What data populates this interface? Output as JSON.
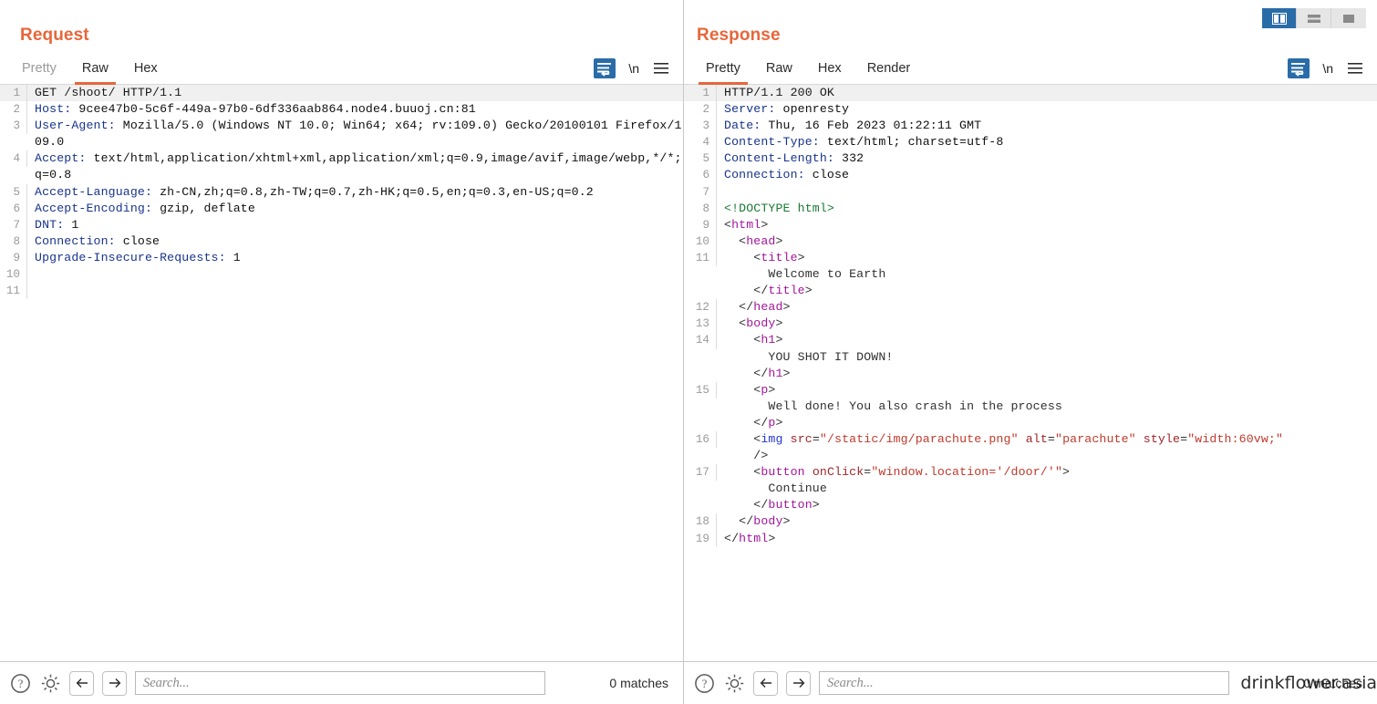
{
  "view_modes": [
    {
      "name": "side-by-side",
      "active": true
    },
    {
      "name": "stacked",
      "active": false
    },
    {
      "name": "single",
      "active": false
    }
  ],
  "request": {
    "title": "Request",
    "tabs": [
      {
        "label": "Pretty",
        "active": false
      },
      {
        "label": "Raw",
        "active": true
      },
      {
        "label": "Hex",
        "active": false
      }
    ],
    "tools": {
      "wrap": "word-wrap-icon",
      "newline": "\\n",
      "menu": "hamburger-menu-icon"
    },
    "lines": [
      {
        "num": "1",
        "segments": [
          {
            "t": "GET /shoot/ HTTP/1.1",
            "c": "plain"
          }
        ]
      },
      {
        "num": "2",
        "segments": [
          {
            "t": "Host: ",
            "c": "hname"
          },
          {
            "t": "9cee47b0-5c6f-449a-97b0-6df336aab864.node4.buuoj.cn:81",
            "c": "hval"
          }
        ]
      },
      {
        "num": "3",
        "segments": [
          {
            "t": "User-Agent: ",
            "c": "hname"
          },
          {
            "t": "Mozilla/5.0 (Windows NT 10.0; Win64; x64; rv:109.0) Gecko/20100101 Firefox/109.0",
            "c": "hval"
          }
        ]
      },
      {
        "num": "4",
        "segments": [
          {
            "t": "Accept: ",
            "c": "hname"
          },
          {
            "t": "text/html,application/xhtml+xml,application/xml;q=0.9,image/avif,image/webp,*/*;q=0.8",
            "c": "hval"
          }
        ]
      },
      {
        "num": "5",
        "segments": [
          {
            "t": "Accept-Language: ",
            "c": "hname"
          },
          {
            "t": "zh-CN,zh;q=0.8,zh-TW;q=0.7,zh-HK;q=0.5,en;q=0.3,en-US;q=0.2",
            "c": "hval"
          }
        ]
      },
      {
        "num": "6",
        "segments": [
          {
            "t": "Accept-Encoding: ",
            "c": "hname"
          },
          {
            "t": "gzip, deflate",
            "c": "hval"
          }
        ]
      },
      {
        "num": "7",
        "segments": [
          {
            "t": "DNT: ",
            "c": "hname"
          },
          {
            "t": "1",
            "c": "hval"
          }
        ]
      },
      {
        "num": "8",
        "segments": [
          {
            "t": "Connection: ",
            "c": "hname"
          },
          {
            "t": "close",
            "c": "hval"
          }
        ]
      },
      {
        "num": "9",
        "segments": [
          {
            "t": "Upgrade-Insecure-Requests: ",
            "c": "hname"
          },
          {
            "t": "1",
            "c": "hval"
          }
        ]
      },
      {
        "num": "10",
        "segments": []
      },
      {
        "num": "11",
        "segments": []
      }
    ],
    "bottom": {
      "help": "help-icon",
      "settings": "gear-icon",
      "prev": "arrow-left-icon",
      "next": "arrow-right-icon",
      "search_placeholder": "Search...",
      "search_value": "",
      "matches": "0 matches"
    }
  },
  "response": {
    "title": "Response",
    "tabs": [
      {
        "label": "Pretty",
        "active": true
      },
      {
        "label": "Raw",
        "active": false
      },
      {
        "label": "Hex",
        "active": false
      },
      {
        "label": "Render",
        "active": false
      }
    ],
    "tools": {
      "wrap": "word-wrap-icon",
      "newline": "\\n",
      "menu": "hamburger-menu-icon"
    },
    "lines": [
      {
        "num": "1",
        "segments": [
          {
            "t": "HTTP/1.1 200 OK",
            "c": "plain"
          }
        ]
      },
      {
        "num": "2",
        "segments": [
          {
            "t": "Server: ",
            "c": "hname"
          },
          {
            "t": "openresty",
            "c": "hval"
          }
        ]
      },
      {
        "num": "3",
        "segments": [
          {
            "t": "Date: ",
            "c": "hname"
          },
          {
            "t": "Thu, 16 Feb 2023 01:22:11 GMT",
            "c": "hval"
          }
        ]
      },
      {
        "num": "4",
        "segments": [
          {
            "t": "Content-Type: ",
            "c": "hname"
          },
          {
            "t": "text/html; charset=utf-8",
            "c": "hval"
          }
        ]
      },
      {
        "num": "5",
        "segments": [
          {
            "t": "Content-Length: ",
            "c": "hname"
          },
          {
            "t": "332",
            "c": "hval"
          }
        ]
      },
      {
        "num": "6",
        "segments": [
          {
            "t": "Connection: ",
            "c": "hname"
          },
          {
            "t": "close",
            "c": "hval"
          }
        ]
      },
      {
        "num": "7",
        "segments": []
      },
      {
        "num": "8",
        "segments": [
          {
            "t": "<!DOCTYPE html>",
            "c": "doctype"
          }
        ]
      },
      {
        "num": "9",
        "segments": [
          {
            "t": "<",
            "c": "punc"
          },
          {
            "t": "html",
            "c": "tagname"
          },
          {
            "t": ">",
            "c": "punc"
          }
        ]
      },
      {
        "num": "10",
        "segments": [
          {
            "t": "  <",
            "c": "punc"
          },
          {
            "t": "head",
            "c": "tagname"
          },
          {
            "t": ">",
            "c": "punc"
          }
        ]
      },
      {
        "num": "11",
        "segments": [
          {
            "t": "    <",
            "c": "punc"
          },
          {
            "t": "title",
            "c": "tagname"
          },
          {
            "t": ">\n      Welcome to Earth\n    </",
            "c": "punc"
          },
          {
            "t": "title",
            "c": "tagname"
          },
          {
            "t": ">",
            "c": "punc"
          }
        ]
      },
      {
        "num": "12",
        "segments": [
          {
            "t": "  </",
            "c": "punc"
          },
          {
            "t": "head",
            "c": "tagname"
          },
          {
            "t": ">",
            "c": "punc"
          }
        ]
      },
      {
        "num": "13",
        "segments": [
          {
            "t": "  <",
            "c": "punc"
          },
          {
            "t": "body",
            "c": "tagname"
          },
          {
            "t": ">",
            "c": "punc"
          }
        ]
      },
      {
        "num": "14",
        "segments": [
          {
            "t": "    <",
            "c": "punc"
          },
          {
            "t": "h1",
            "c": "tagname"
          },
          {
            "t": ">\n      YOU SHOT IT DOWN!\n    </",
            "c": "punc"
          },
          {
            "t": "h1",
            "c": "tagname"
          },
          {
            "t": ">",
            "c": "punc"
          }
        ]
      },
      {
        "num": "15",
        "segments": [
          {
            "t": "    <",
            "c": "punc"
          },
          {
            "t": "p",
            "c": "tagname"
          },
          {
            "t": ">\n      Well done! You also crash in the process\n    </",
            "c": "punc"
          },
          {
            "t": "p",
            "c": "tagname"
          },
          {
            "t": ">",
            "c": "punc"
          }
        ]
      },
      {
        "num": "16",
        "segments": [
          {
            "t": "    <",
            "c": "punc"
          },
          {
            "t": "img",
            "c": "tagname2"
          },
          {
            "t": " ",
            "c": "punc"
          },
          {
            "t": "src",
            "c": "attr"
          },
          {
            "t": "=",
            "c": "punc"
          },
          {
            "t": "\"/static/img/parachute.png\"",
            "c": "attrval"
          },
          {
            "t": " ",
            "c": "punc"
          },
          {
            "t": "alt",
            "c": "attr"
          },
          {
            "t": "=",
            "c": "punc"
          },
          {
            "t": "\"parachute\"",
            "c": "attrval"
          },
          {
            "t": " ",
            "c": "punc"
          },
          {
            "t": "style",
            "c": "attr"
          },
          {
            "t": "=",
            "c": "punc"
          },
          {
            "t": "\"width:60vw;\"",
            "c": "attrval"
          },
          {
            "t": "\n    />",
            "c": "punc"
          }
        ]
      },
      {
        "num": "17",
        "segments": [
          {
            "t": "    <",
            "c": "punc"
          },
          {
            "t": "button",
            "c": "tagname"
          },
          {
            "t": " ",
            "c": "punc"
          },
          {
            "t": "onClick",
            "c": "attr"
          },
          {
            "t": "=",
            "c": "punc"
          },
          {
            "t": "\"window.location='/door/'\"",
            "c": "attrval"
          },
          {
            "t": ">\n      Continue\n    </",
            "c": "punc"
          },
          {
            "t": "button",
            "c": "tagname"
          },
          {
            "t": ">",
            "c": "punc"
          }
        ]
      },
      {
        "num": "18",
        "segments": [
          {
            "t": "  </",
            "c": "punc"
          },
          {
            "t": "body",
            "c": "tagname"
          },
          {
            "t": ">",
            "c": "punc"
          }
        ]
      },
      {
        "num": "19",
        "segments": [
          {
            "t": "</",
            "c": "punc"
          },
          {
            "t": "html",
            "c": "tagname"
          },
          {
            "t": ">",
            "c": "punc"
          }
        ]
      }
    ],
    "bottom": {
      "help": "help-icon",
      "settings": "gear-icon",
      "prev": "arrow-left-icon",
      "next": "arrow-right-icon",
      "search_placeholder": "Search...",
      "search_value": "",
      "matches": "0 matches",
      "watermark": "drinkflower.asia"
    }
  },
  "colors": {
    "accent": "#e8663a",
    "active_tool": "#2a6ca8",
    "header_name": "#18348c",
    "doctype": "#1a7a33",
    "tag": "#a3159b",
    "attr_value": "#c0392b"
  }
}
